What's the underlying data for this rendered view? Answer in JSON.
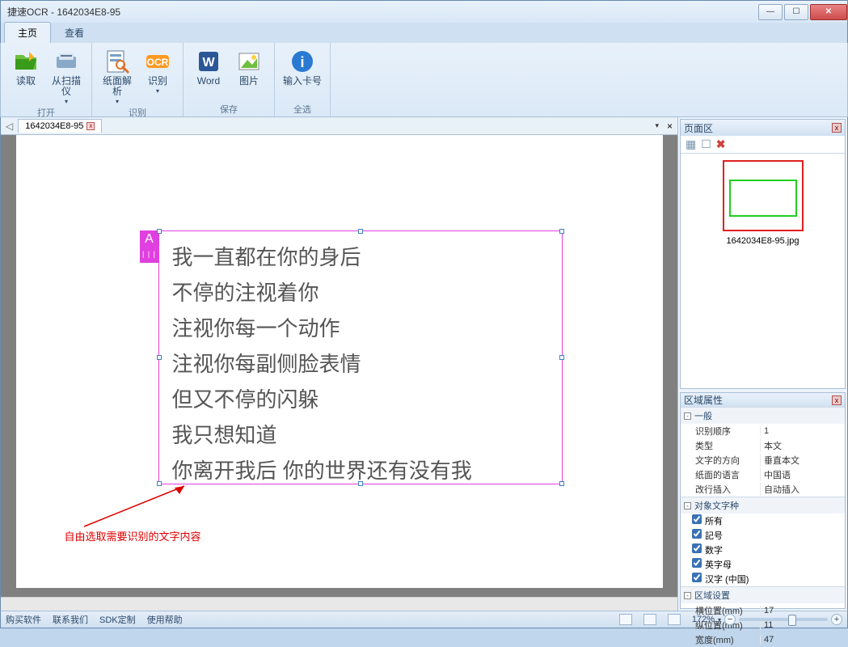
{
  "window": {
    "title": "捷速OCR - 1642034E8-95"
  },
  "tabs": {
    "home": "主页",
    "view": "查看"
  },
  "ribbon": {
    "open": {
      "read": "读取",
      "scanner": "从扫描仪",
      "label": "打开"
    },
    "recognize": {
      "parse": "纸面解析",
      "ocr": "识别",
      "label": "识别"
    },
    "save": {
      "word": "Word",
      "image": "图片",
      "label": "保存"
    },
    "selectall": {
      "card": "输入卡号",
      "label": "全选"
    }
  },
  "doc": {
    "name": "1642034E8-95"
  },
  "selection": {
    "tag": "A",
    "lines": [
      "我一直都在你的身后",
      "不停的注视着你",
      "注视你每一个动作",
      "注视你每副侧脸表情",
      "但又不停的闪躲",
      "我只想知道",
      "你离开我后 你的世界还有没有我"
    ]
  },
  "annotation": "自由选取需要识别的文字内容",
  "pagepanel": {
    "title": "页面区",
    "thumb_label": "1642034E8-95.jpg"
  },
  "proppanel": {
    "title": "区域属性",
    "sec_general": "一般",
    "rows_general": {
      "order_k": "识别顺序",
      "order_v": "1",
      "type_k": "类型",
      "type_v": "本文",
      "dir_k": "文字的方向",
      "dir_v": "垂直本文",
      "lang_k": "纸面的语言",
      "lang_v": "中国语",
      "ins_k": "改行插入",
      "ins_v": "自动插入"
    },
    "sec_charset": "对象文字种",
    "chk": {
      "all": "所有",
      "symbol": "記号",
      "digit": "数字",
      "alpha": "英字母",
      "cjk": "汉字 (中国)"
    },
    "sec_region": "区域设置",
    "rows_region": {
      "x_k": "横位置(mm)",
      "x_v": "17",
      "y_k": "纵位置(mm)",
      "y_v": "11",
      "w_k": "宽度(mm)",
      "w_v": "47"
    }
  },
  "status": {
    "buy": "购买软件",
    "contact": "联系我们",
    "sdk": "SDK定制",
    "help": "使用帮助",
    "zoom": "172%"
  }
}
